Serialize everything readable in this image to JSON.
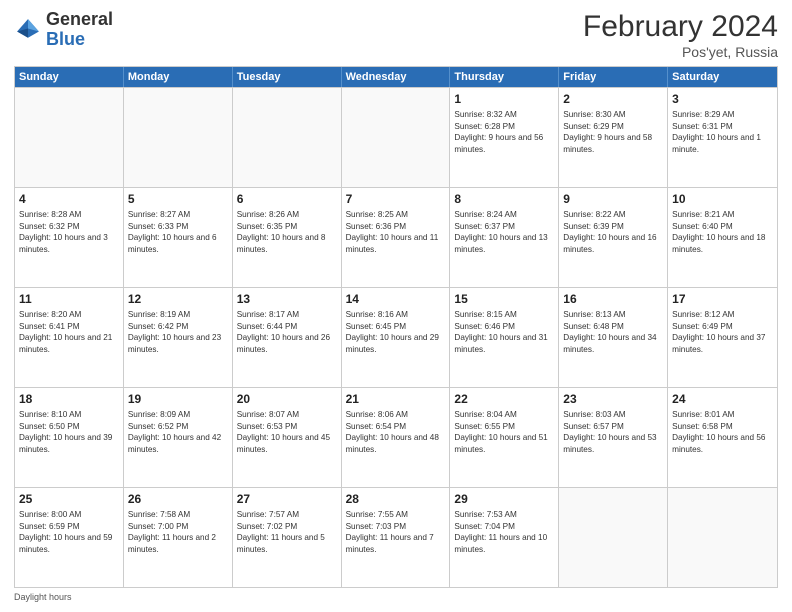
{
  "logo": {
    "general": "General",
    "blue": "Blue"
  },
  "title": {
    "month": "February 2024",
    "location": "Pos'yet, Russia"
  },
  "header_days": [
    "Sunday",
    "Monday",
    "Tuesday",
    "Wednesday",
    "Thursday",
    "Friday",
    "Saturday"
  ],
  "rows": [
    [
      {
        "day": "",
        "text": "",
        "empty": true
      },
      {
        "day": "",
        "text": "",
        "empty": true
      },
      {
        "day": "",
        "text": "",
        "empty": true
      },
      {
        "day": "",
        "text": "",
        "empty": true
      },
      {
        "day": "1",
        "text": "Sunrise: 8:32 AM\nSunset: 6:28 PM\nDaylight: 9 hours and 56 minutes.",
        "empty": false
      },
      {
        "day": "2",
        "text": "Sunrise: 8:30 AM\nSunset: 6:29 PM\nDaylight: 9 hours and 58 minutes.",
        "empty": false
      },
      {
        "day": "3",
        "text": "Sunrise: 8:29 AM\nSunset: 6:31 PM\nDaylight: 10 hours and 1 minute.",
        "empty": false
      }
    ],
    [
      {
        "day": "4",
        "text": "Sunrise: 8:28 AM\nSunset: 6:32 PM\nDaylight: 10 hours and 3 minutes.",
        "empty": false
      },
      {
        "day": "5",
        "text": "Sunrise: 8:27 AM\nSunset: 6:33 PM\nDaylight: 10 hours and 6 minutes.",
        "empty": false
      },
      {
        "day": "6",
        "text": "Sunrise: 8:26 AM\nSunset: 6:35 PM\nDaylight: 10 hours and 8 minutes.",
        "empty": false
      },
      {
        "day": "7",
        "text": "Sunrise: 8:25 AM\nSunset: 6:36 PM\nDaylight: 10 hours and 11 minutes.",
        "empty": false
      },
      {
        "day": "8",
        "text": "Sunrise: 8:24 AM\nSunset: 6:37 PM\nDaylight: 10 hours and 13 minutes.",
        "empty": false
      },
      {
        "day": "9",
        "text": "Sunrise: 8:22 AM\nSunset: 6:39 PM\nDaylight: 10 hours and 16 minutes.",
        "empty": false
      },
      {
        "day": "10",
        "text": "Sunrise: 8:21 AM\nSunset: 6:40 PM\nDaylight: 10 hours and 18 minutes.",
        "empty": false
      }
    ],
    [
      {
        "day": "11",
        "text": "Sunrise: 8:20 AM\nSunset: 6:41 PM\nDaylight: 10 hours and 21 minutes.",
        "empty": false
      },
      {
        "day": "12",
        "text": "Sunrise: 8:19 AM\nSunset: 6:42 PM\nDaylight: 10 hours and 23 minutes.",
        "empty": false
      },
      {
        "day": "13",
        "text": "Sunrise: 8:17 AM\nSunset: 6:44 PM\nDaylight: 10 hours and 26 minutes.",
        "empty": false
      },
      {
        "day": "14",
        "text": "Sunrise: 8:16 AM\nSunset: 6:45 PM\nDaylight: 10 hours and 29 minutes.",
        "empty": false
      },
      {
        "day": "15",
        "text": "Sunrise: 8:15 AM\nSunset: 6:46 PM\nDaylight: 10 hours and 31 minutes.",
        "empty": false
      },
      {
        "day": "16",
        "text": "Sunrise: 8:13 AM\nSunset: 6:48 PM\nDaylight: 10 hours and 34 minutes.",
        "empty": false
      },
      {
        "day": "17",
        "text": "Sunrise: 8:12 AM\nSunset: 6:49 PM\nDaylight: 10 hours and 37 minutes.",
        "empty": false
      }
    ],
    [
      {
        "day": "18",
        "text": "Sunrise: 8:10 AM\nSunset: 6:50 PM\nDaylight: 10 hours and 39 minutes.",
        "empty": false
      },
      {
        "day": "19",
        "text": "Sunrise: 8:09 AM\nSunset: 6:52 PM\nDaylight: 10 hours and 42 minutes.",
        "empty": false
      },
      {
        "day": "20",
        "text": "Sunrise: 8:07 AM\nSunset: 6:53 PM\nDaylight: 10 hours and 45 minutes.",
        "empty": false
      },
      {
        "day": "21",
        "text": "Sunrise: 8:06 AM\nSunset: 6:54 PM\nDaylight: 10 hours and 48 minutes.",
        "empty": false
      },
      {
        "day": "22",
        "text": "Sunrise: 8:04 AM\nSunset: 6:55 PM\nDaylight: 10 hours and 51 minutes.",
        "empty": false
      },
      {
        "day": "23",
        "text": "Sunrise: 8:03 AM\nSunset: 6:57 PM\nDaylight: 10 hours and 53 minutes.",
        "empty": false
      },
      {
        "day": "24",
        "text": "Sunrise: 8:01 AM\nSunset: 6:58 PM\nDaylight: 10 hours and 56 minutes.",
        "empty": false
      }
    ],
    [
      {
        "day": "25",
        "text": "Sunrise: 8:00 AM\nSunset: 6:59 PM\nDaylight: 10 hours and 59 minutes.",
        "empty": false
      },
      {
        "day": "26",
        "text": "Sunrise: 7:58 AM\nSunset: 7:00 PM\nDaylight: 11 hours and 2 minutes.",
        "empty": false
      },
      {
        "day": "27",
        "text": "Sunrise: 7:57 AM\nSunset: 7:02 PM\nDaylight: 11 hours and 5 minutes.",
        "empty": false
      },
      {
        "day": "28",
        "text": "Sunrise: 7:55 AM\nSunset: 7:03 PM\nDaylight: 11 hours and 7 minutes.",
        "empty": false
      },
      {
        "day": "29",
        "text": "Sunrise: 7:53 AM\nSunset: 7:04 PM\nDaylight: 11 hours and 10 minutes.",
        "empty": false
      },
      {
        "day": "",
        "text": "",
        "empty": true
      },
      {
        "day": "",
        "text": "",
        "empty": true
      }
    ]
  ],
  "footer": {
    "daylight_label": "Daylight hours"
  }
}
